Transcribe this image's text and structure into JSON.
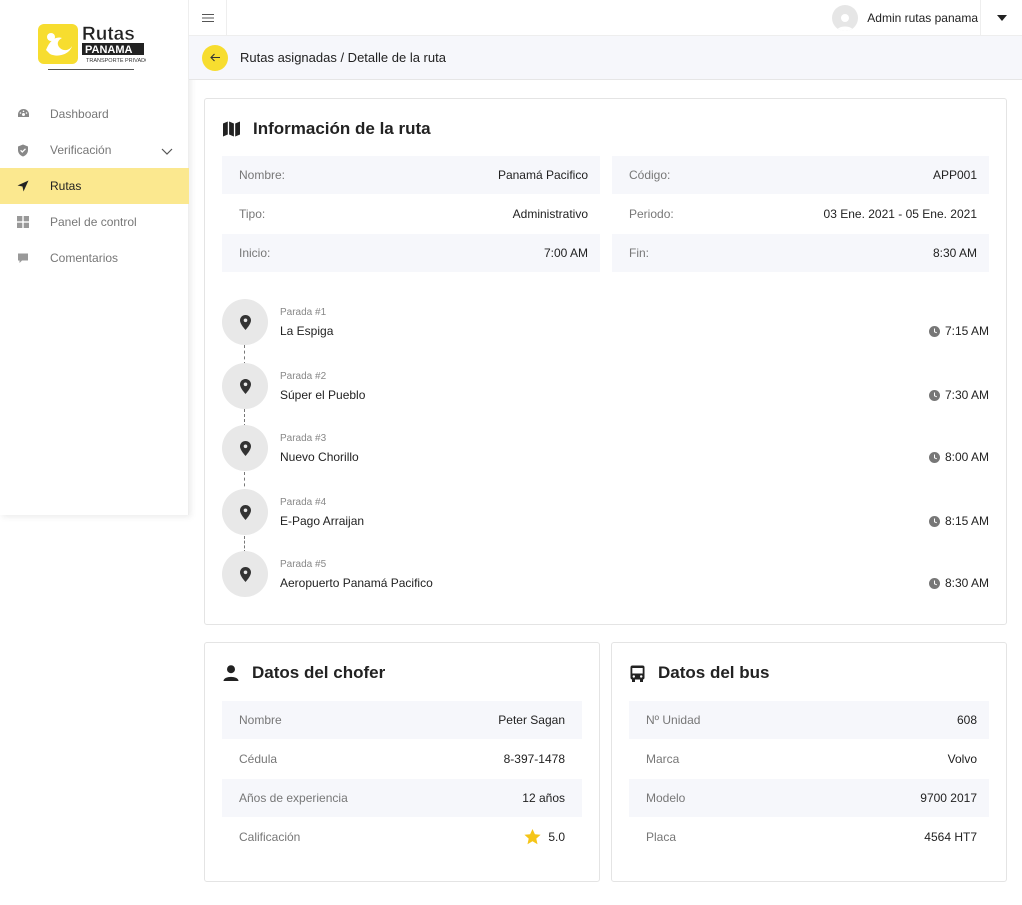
{
  "brand": {
    "name": "Rutas",
    "name2": "PANAMA",
    "tagline": "TRANSPORTE PRIVADO"
  },
  "sidebar": {
    "items": [
      {
        "label": "Dashboard",
        "icon": "gauge-icon"
      },
      {
        "label": "Verificación",
        "icon": "shield-icon"
      },
      {
        "label": "Rutas",
        "icon": "navigation-arrow-icon"
      },
      {
        "label": "Panel de control",
        "icon": "grid-icon"
      },
      {
        "label": "Comentarios",
        "icon": "comment-icon"
      }
    ]
  },
  "topbar": {
    "user_name": "Admin rutas panama"
  },
  "breadcrumb": {
    "text": "Rutas asignadas / Detalle de la ruta"
  },
  "route": {
    "title": "Información de la ruta",
    "left": [
      {
        "key": "Nombre:",
        "value": "Panamá Pacifico"
      },
      {
        "key": "Tipo:",
        "value": "Administrativo"
      },
      {
        "key": "Inicio:",
        "value": "7:00 AM"
      }
    ],
    "right": [
      {
        "key": "Código:",
        "value": "APP001"
      },
      {
        "key": "Periodo:",
        "value": "03 Ene. 2021 - 05 Ene. 2021"
      },
      {
        "key": "Fin:",
        "value": "8:30 AM"
      }
    ],
    "stops": [
      {
        "label": "Parada #1",
        "name": "La Espiga",
        "time": "7:15 AM"
      },
      {
        "label": "Parada #2",
        "name": "Súper el Pueblo",
        "time": "7:30 AM"
      },
      {
        "label": "Parada #3",
        "name": "Nuevo Chorillo",
        "time": "8:00 AM"
      },
      {
        "label": "Parada #4",
        "name": "E-Pago Arraijan",
        "time": "8:15 AM"
      },
      {
        "label": "Parada #5",
        "name": "Aeropuerto Panamá Pacifico",
        "time": "8:30 AM"
      }
    ]
  },
  "driver": {
    "title": "Datos del chofer",
    "rows": [
      {
        "key": "Nombre",
        "value": "Peter Sagan"
      },
      {
        "key": "Cédula",
        "value": "8-397-1478"
      },
      {
        "key": "Años de experiencia",
        "value": "12 años"
      },
      {
        "key": "Calificación",
        "value": "5.0"
      }
    ]
  },
  "bus": {
    "title": "Datos del bus",
    "rows": [
      {
        "key": "Nº Unidad",
        "value": "608"
      },
      {
        "key": "Marca",
        "value": "Volvo"
      },
      {
        "key": "Modelo",
        "value": "9700 2017"
      },
      {
        "key": "Placa",
        "value": "4564 HT7"
      }
    ]
  },
  "colors": {
    "accent": "#f7dd2f",
    "active_bg": "#fbe88f",
    "row_shade": "#f6f7fb",
    "star": "#f5c518"
  }
}
